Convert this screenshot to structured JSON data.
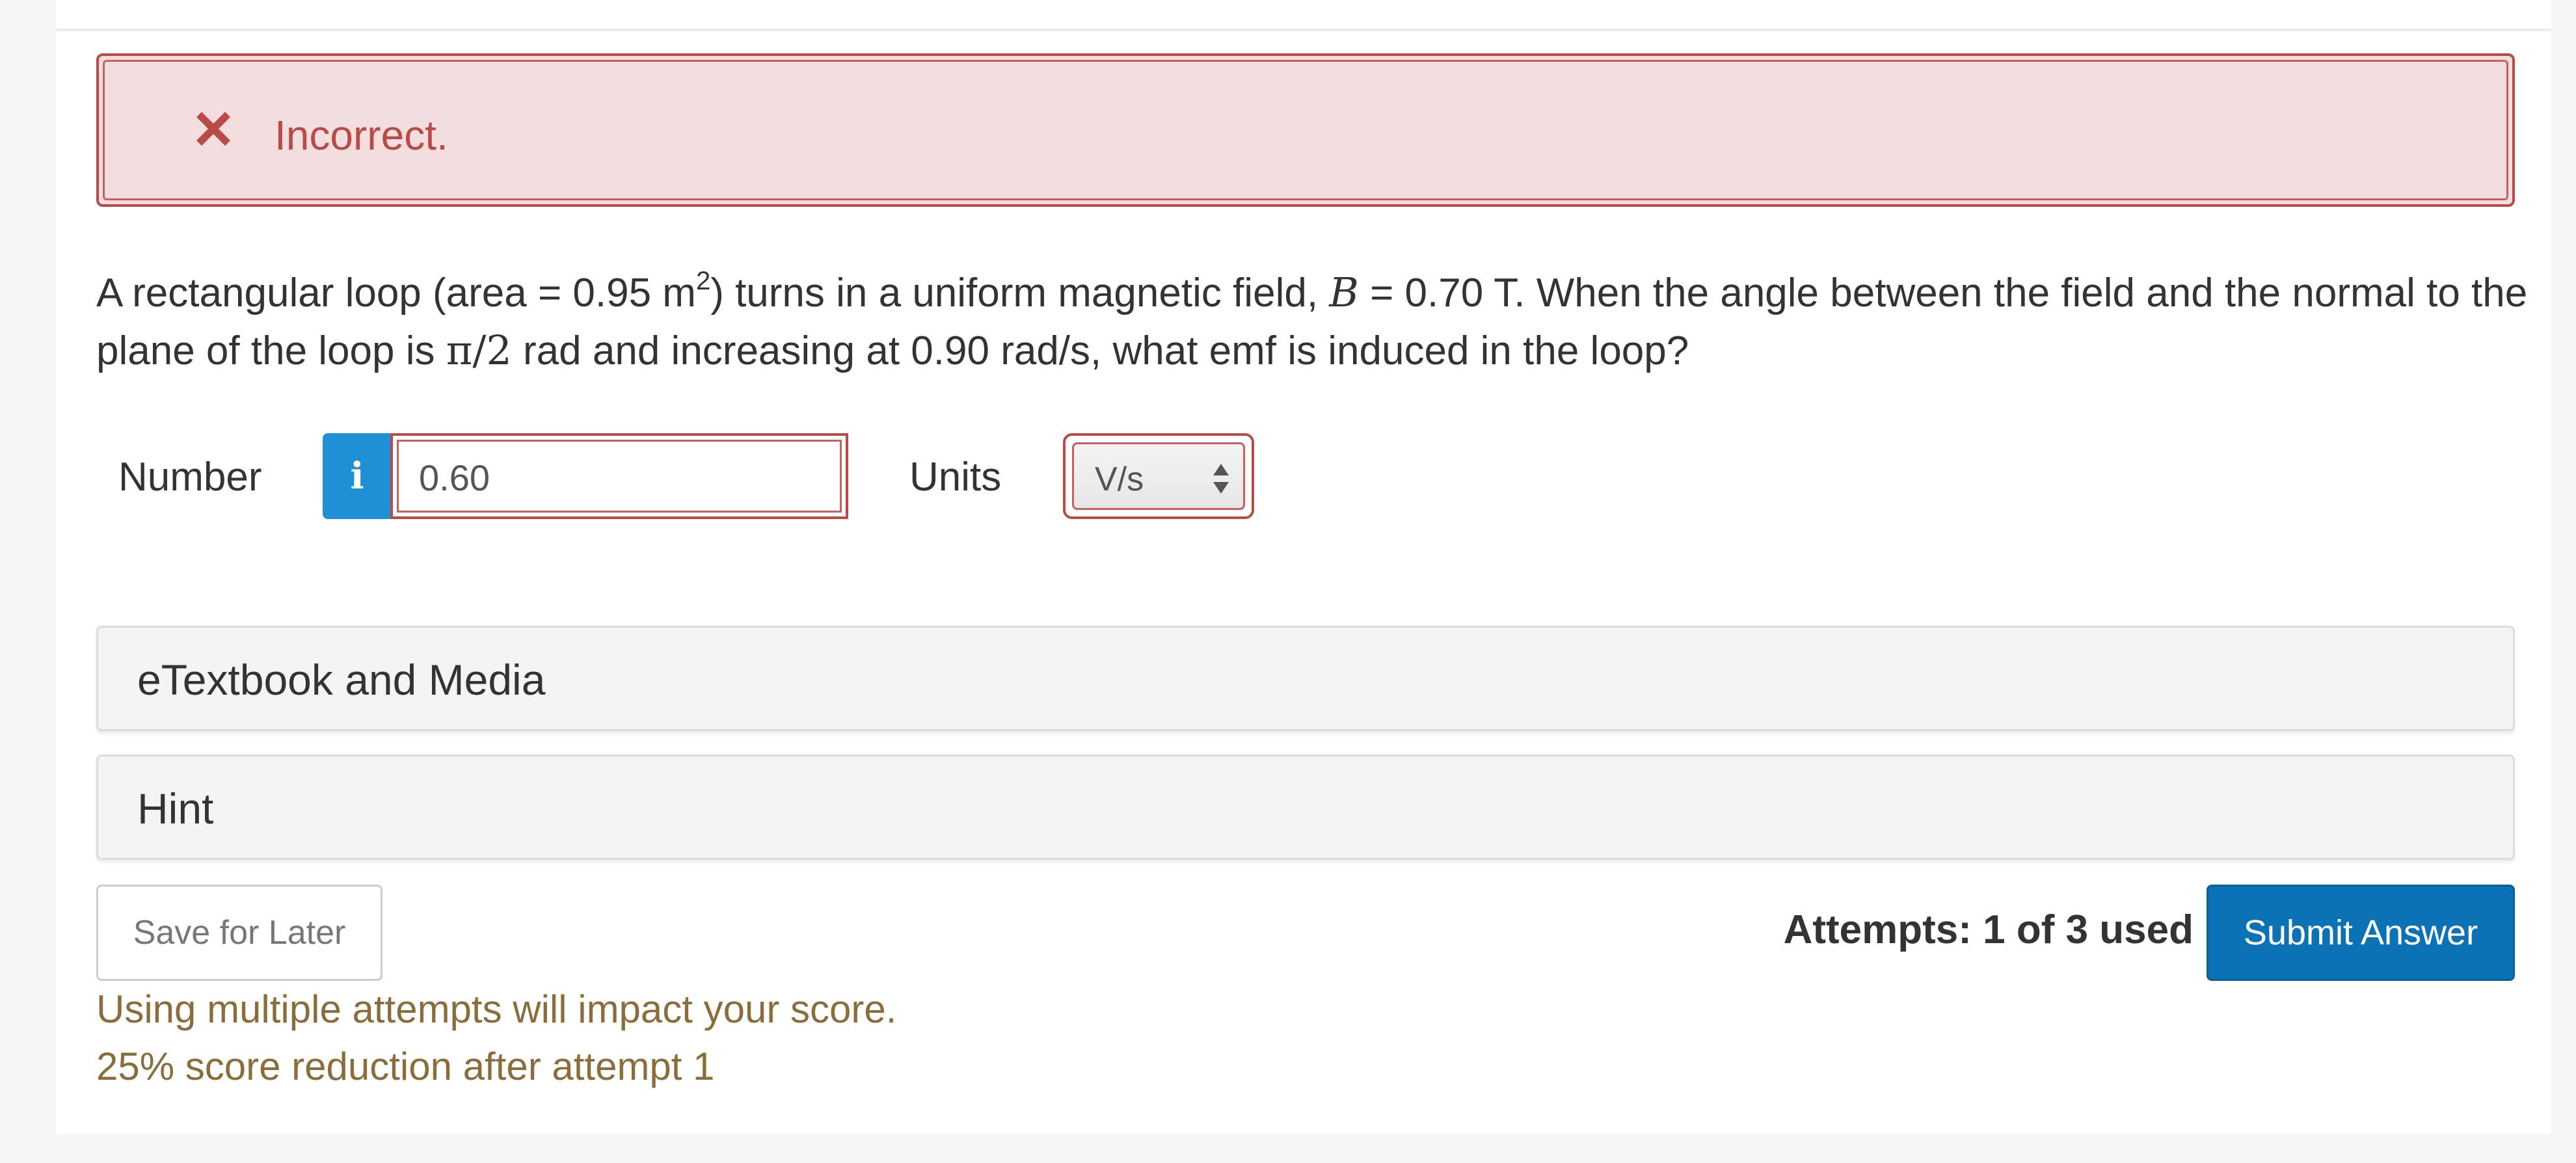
{
  "feedback": {
    "status": "Incorrect.",
    "icon": "x-mark-icon",
    "color": "#b94a48"
  },
  "question": {
    "part1": "A rectangular loop (area = 0.95 m",
    "sup": "2",
    "part2": ") turns in a uniform magnetic field, ",
    "var_b": "B",
    "part3": " = 0.70 T. When the angle between the field and the normal to the plane of the loop is ",
    "angle": "π/2",
    "part4": " rad and increasing at 0.90 rad/s, what emf is induced in the loop?"
  },
  "answer": {
    "number_label": "Number",
    "info_icon": "info-icon",
    "number_value": "0.60",
    "units_label": "Units",
    "units_value": "V/s"
  },
  "panels": {
    "media": "eTextbook and Media",
    "hint": "Hint"
  },
  "actions": {
    "save_label": "Save for Later",
    "attempts": "Attempts: 1 of 3 used",
    "submit_label": "Submit Answer",
    "submit_color": "#0b72b5"
  },
  "notice": {
    "line1": "Using multiple attempts will impact your score.",
    "line2": "25% score reduction after attempt 1",
    "color": "#8a6d3b"
  }
}
